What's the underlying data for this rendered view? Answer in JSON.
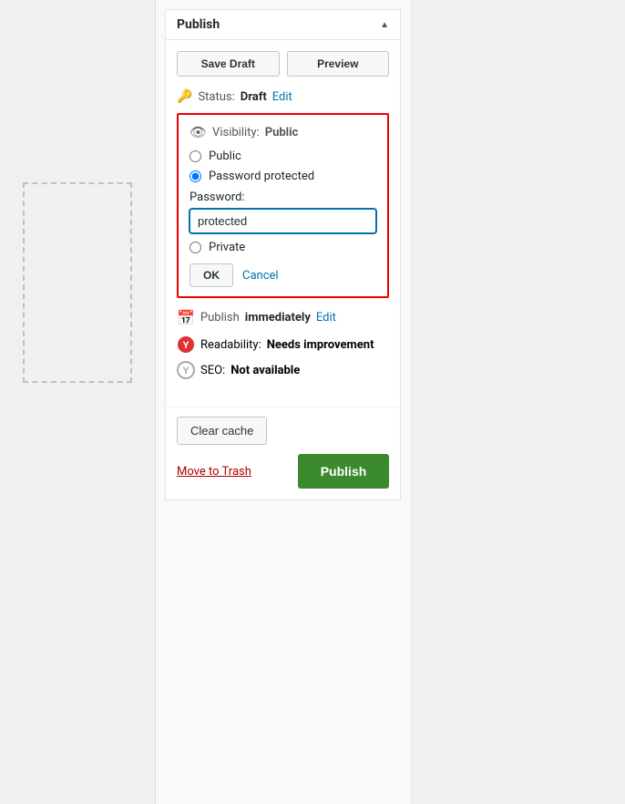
{
  "panel": {
    "title": "Publish",
    "toggle_icon": "▲"
  },
  "buttons": {
    "save_draft": "Save Draft",
    "preview": "Preview",
    "publish": "Publish",
    "ok": "OK",
    "clear_cache": "Clear cache"
  },
  "status": {
    "label": "Status:",
    "value": "Draft",
    "edit_link": "Edit"
  },
  "visibility": {
    "label": "Visibility:",
    "value": "Public",
    "options": [
      "Public",
      "Password protected",
      "Private"
    ],
    "selected": "Password protected",
    "password_label": "Password:",
    "password_value": "protected",
    "cancel_link": "Cancel"
  },
  "publish_time": {
    "label": "Publish",
    "value": "immediately",
    "edit_link": "Edit"
  },
  "readability": {
    "label": "Readability:",
    "value": "Needs improvement"
  },
  "seo": {
    "label": "SEO:",
    "value": "Not available"
  },
  "trash": {
    "label": "Move to Trash"
  },
  "icons": {
    "key": "🔑",
    "eye": "👁",
    "calendar": "📅",
    "yoast_red": "Y",
    "yoast_gray": "Y"
  }
}
